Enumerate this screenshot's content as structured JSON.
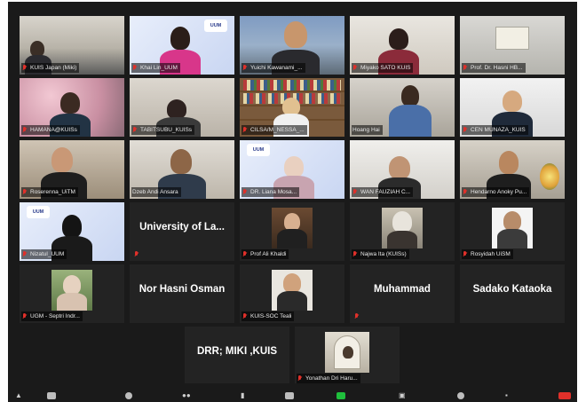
{
  "colors": {
    "background": "#1a1a1a",
    "active_speaker_outline": "#c9d23b",
    "muted_icon": "#e0302a",
    "share_screen": "#1fbf3c",
    "end_button": "#e0302a"
  },
  "participants": [
    {
      "label": "KUIS Japan (Miki)",
      "muted": true
    },
    {
      "label": "Khai Lin_UUM",
      "muted": true,
      "logo": "UUM"
    },
    {
      "label": "Yuichi Kawanami_...",
      "muted": true
    },
    {
      "label": "Miyako SATO KUIS",
      "muted": true
    },
    {
      "label": "Prof. Dr. Hasni HB...",
      "muted": true
    },
    {
      "label": "HAMANA@KUISs",
      "muted": true
    },
    {
      "label": "TABITSUBU_KUISs",
      "muted": true
    },
    {
      "label": "CILSA/M_NESSA_...",
      "muted": true
    },
    {
      "label": "Hoang Hai",
      "muted": false
    },
    {
      "label": "CEN MUNAZA_KUIS",
      "muted": true
    },
    {
      "label": "Roserenna_UiTM",
      "muted": true
    },
    {
      "label": "Dzeb Andi Ansara",
      "muted": false
    },
    {
      "label": "DR. Liana Mosa...",
      "muted": true,
      "logo": "UUM"
    },
    {
      "label": "WAN FAUZIAH C...",
      "muted": true
    },
    {
      "label": "Hendarno Anoky Pu...",
      "muted": true
    },
    {
      "label": "Nizatul_UUM",
      "muted": true,
      "logo": "UUM"
    },
    {
      "display_name": "University of La...",
      "muted": true
    },
    {
      "label": "Prof Ali Khaldi",
      "muted": true
    },
    {
      "label": "Najwa Ita (KUISs)",
      "muted": true
    },
    {
      "label": "Rosyidah UiSM",
      "muted": true
    },
    {
      "label": "UGM - Septri Indr...",
      "muted": true
    },
    {
      "display_name": "Nor Hasni Osman",
      "muted": false
    },
    {
      "label": "KUIS-SOC Teali",
      "muted": true
    },
    {
      "display_name": "Muhammad",
      "muted": true
    },
    {
      "display_name": "Sadako Kataoka",
      "muted": false
    },
    {
      "display_name": "DRR; MIKI ,KUIS",
      "muted": false
    },
    {
      "label": "Yonathan Dri Haru...",
      "muted": true
    }
  ],
  "toolbar": {
    "items": [
      "mute-audio",
      "start-video",
      "security",
      "participants",
      "chat",
      "share-screen",
      "record",
      "reactions",
      "apps",
      "end"
    ]
  }
}
